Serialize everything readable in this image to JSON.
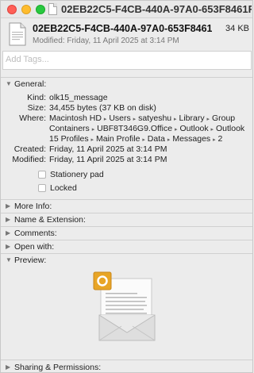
{
  "titlebar": {
    "title": "02EB22C5-F4CB-440A-97A0-653F8461F..."
  },
  "header": {
    "file_name": "02EB22C5-F4CB-440A-97A0-653F8461...",
    "file_size": "34 KB",
    "modified": "Modified: Friday, 11 April 2025 at 3:14 PM"
  },
  "tags": {
    "placeholder": "Add Tags..."
  },
  "sections": {
    "general": "General:",
    "more_info": "More Info:",
    "name_extension": "Name & Extension:",
    "comments": "Comments:",
    "open_with": "Open with:",
    "preview": "Preview:",
    "sharing": "Sharing & Permissions:"
  },
  "general": {
    "kind_label": "Kind:",
    "kind_value": "olk15_message",
    "size_label": "Size:",
    "size_value": "34,455 bytes (37 KB on disk)",
    "where_label": "Where:",
    "where_path": [
      "Macintosh HD",
      "Users",
      "satyeshu",
      "Library",
      "Group Containers",
      "UBF8T346G9.Office",
      "Outlook",
      "Outlook 15 Profiles",
      "Main Profile",
      "Data",
      "Messages",
      "2"
    ],
    "created_label": "Created:",
    "created_value": "Friday, 11 April 2025 at 3:14 PM",
    "modified_label": "Modified:",
    "modified_value": "Friday, 11 April 2025 at 3:14 PM",
    "stationery_label": "Stationery pad",
    "locked_label": "Locked"
  },
  "preview": {
    "icon": "outlook-message-icon",
    "badge_letter": "O"
  },
  "colors": {
    "background": "#ececec",
    "outlook_badge": "#e8a526",
    "envelope": "#d9d9d9"
  }
}
